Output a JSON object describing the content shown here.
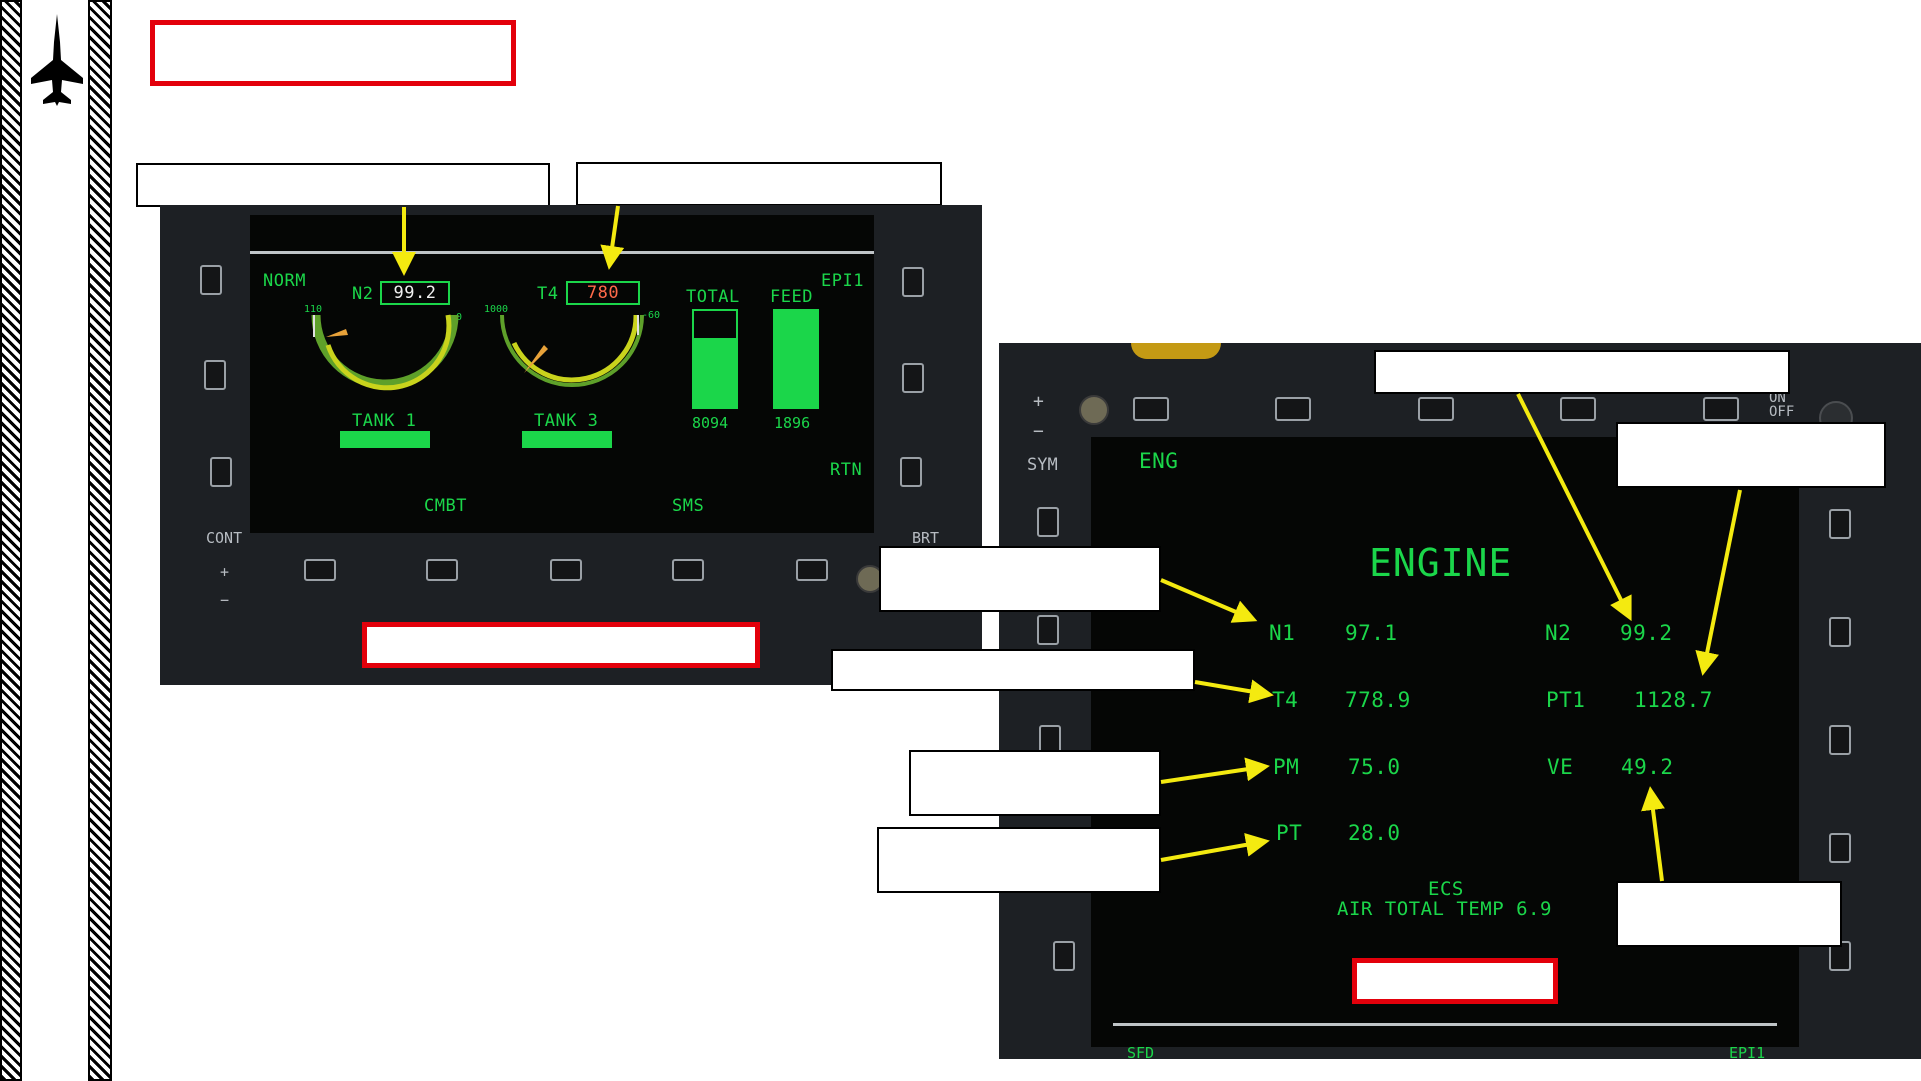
{
  "left_display": {
    "mode": "NORM",
    "page": "EPI1",
    "n2_label": "N2",
    "n2_value": "99.2",
    "n2_scale_max": "110",
    "n2_scale_min": "0",
    "t4_label": "T4",
    "t4_value": "780",
    "t4_scale_max": "1000",
    "t4_scale_min": "-60",
    "total_label": "TOTAL",
    "total_value": "8094",
    "total_fill": 0.72,
    "feed_label": "FEED",
    "feed_value": "1896",
    "feed_fill": 1.0,
    "tank1_label": "TANK 1",
    "tank3_label": "TANK 3",
    "rtn_label": "RTN",
    "cmbt_label": "CMBT",
    "sms_label": "SMS",
    "cont_label": "CONT",
    "brt_label": "BRT",
    "plus": "+",
    "minus": "−"
  },
  "right_display": {
    "page_label": "ENG",
    "sym_label": "SYM",
    "onoff_label": "ON OFF",
    "title": "ENGINE",
    "params": [
      {
        "label": "N1",
        "value": "97.1"
      },
      {
        "label": "T4",
        "value": "778.9"
      },
      {
        "label": "PM",
        "value": "75.0"
      },
      {
        "label": "PT",
        "value": "28.0"
      },
      {
        "label": "N2",
        "value": "99.2"
      },
      {
        "label": "PT1",
        "value": "1128.7"
      },
      {
        "label": "VE",
        "value": "49.2"
      }
    ],
    "ecs_label": "ECS",
    "ecs_line": "AIR TOTAL TEMP 6.9",
    "bottom_left": "SFD",
    "bottom_right": "EPI1",
    "plus": "+",
    "minus": "−"
  },
  "colors": {
    "mfd_green": "#1bd64a",
    "callout_arrow": "#f4ea10",
    "red_frame": "#e3000b",
    "gauge_yellow": "#c9d31c",
    "t4_value": "#ff6a4a"
  },
  "icons": {
    "sidebar": "jet-silhouette-icon"
  }
}
